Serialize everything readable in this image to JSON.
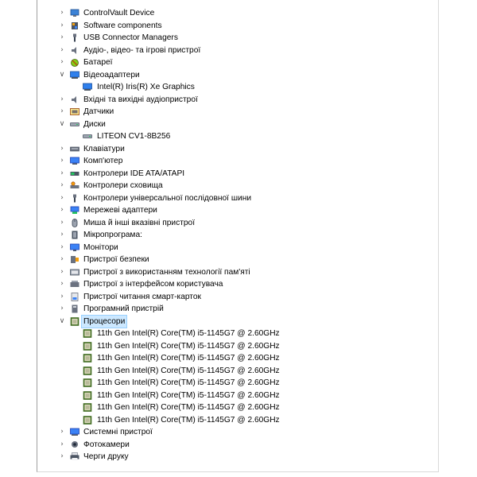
{
  "tree": {
    "items": [
      {
        "label": "ControlVault Device",
        "icon": "controlvault-icon",
        "state": "collapsed"
      },
      {
        "label": "Software components",
        "icon": "software-components-icon",
        "state": "collapsed"
      },
      {
        "label": "USB Connector Managers",
        "icon": "usb-icon",
        "state": "collapsed"
      },
      {
        "label": "Аудіо-, відео- та ігрові пристрої",
        "icon": "speaker-icon",
        "state": "collapsed"
      },
      {
        "label": "Батареї",
        "icon": "battery-icon",
        "state": "collapsed"
      },
      {
        "label": "Відеоадаптери",
        "icon": "display-adapter-icon",
        "state": "expanded"
      },
      {
        "label": "Intel(R) Iris(R) Xe Graphics",
        "icon": "display-adapter-icon",
        "state": "child"
      },
      {
        "label": "Вхідні та вихідні аудіопристрої",
        "icon": "speaker-icon",
        "state": "collapsed"
      },
      {
        "label": "Датчики",
        "icon": "sensor-icon",
        "state": "collapsed"
      },
      {
        "label": "Диски",
        "icon": "disk-icon",
        "state": "expanded"
      },
      {
        "label": "LITEON CV1-8B256",
        "icon": "disk-icon",
        "state": "child"
      },
      {
        "label": "Клавіатури",
        "icon": "keyboard-icon",
        "state": "collapsed"
      },
      {
        "label": "Комп'ютер",
        "icon": "computer-icon",
        "state": "collapsed"
      },
      {
        "label": "Контролери IDE ATA/ATAPI",
        "icon": "ide-controller-icon",
        "state": "collapsed"
      },
      {
        "label": "Контролери сховища",
        "icon": "storage-controller-icon",
        "state": "collapsed"
      },
      {
        "label": "Контролери універсальної послідовної шини",
        "icon": "usb-icon",
        "state": "collapsed"
      },
      {
        "label": "Мережеві адаптери",
        "icon": "network-adapter-icon",
        "state": "collapsed"
      },
      {
        "label": "Миша й інші вказівні пристрої",
        "icon": "mouse-icon",
        "state": "collapsed"
      },
      {
        "label": "Мікропрограма:",
        "icon": "firmware-icon",
        "state": "collapsed"
      },
      {
        "label": "Монітори",
        "icon": "monitor-icon",
        "state": "collapsed"
      },
      {
        "label": "Пристрої безпеки",
        "icon": "security-device-icon",
        "state": "collapsed"
      },
      {
        "label": "Пристрої з використанням технології пам'яті",
        "icon": "memory-device-icon",
        "state": "collapsed"
      },
      {
        "label": "Пристрої з інтерфейсом користувача",
        "icon": "hid-icon",
        "state": "collapsed"
      },
      {
        "label": "Пристрої читання смарт-карток",
        "icon": "smartcard-reader-icon",
        "state": "collapsed"
      },
      {
        "label": "Програмний пристрій",
        "icon": "software-device-icon",
        "state": "collapsed"
      },
      {
        "label": "Процесори",
        "icon": "processor-icon",
        "state": "expanded-selected"
      },
      {
        "label": "11th Gen Intel(R) Core(TM) i5-1145G7 @ 2.60GHz",
        "icon": "processor-icon",
        "state": "child"
      },
      {
        "label": "11th Gen Intel(R) Core(TM) i5-1145G7 @ 2.60GHz",
        "icon": "processor-icon",
        "state": "child"
      },
      {
        "label": "11th Gen Intel(R) Core(TM) i5-1145G7 @ 2.60GHz",
        "icon": "processor-icon",
        "state": "child"
      },
      {
        "label": "11th Gen Intel(R) Core(TM) i5-1145G7 @ 2.60GHz",
        "icon": "processor-icon",
        "state": "child"
      },
      {
        "label": "11th Gen Intel(R) Core(TM) i5-1145G7 @ 2.60GHz",
        "icon": "processor-icon",
        "state": "child"
      },
      {
        "label": "11th Gen Intel(R) Core(TM) i5-1145G7 @ 2.60GHz",
        "icon": "processor-icon",
        "state": "child"
      },
      {
        "label": "11th Gen Intel(R) Core(TM) i5-1145G7 @ 2.60GHz",
        "icon": "processor-icon",
        "state": "child"
      },
      {
        "label": "11th Gen Intel(R) Core(TM) i5-1145G7 @ 2.60GHz",
        "icon": "processor-icon",
        "state": "child"
      },
      {
        "label": "Системні пристрої",
        "icon": "system-device-icon",
        "state": "collapsed"
      },
      {
        "label": "Фотокамери",
        "icon": "camera-icon",
        "state": "collapsed"
      },
      {
        "label": "Черги друку",
        "icon": "printer-icon",
        "state": "collapsed"
      }
    ]
  },
  "colors": {
    "selection_bg": "#cce8ff",
    "selection_border": "#99d1ff",
    "chevron": "#555555"
  }
}
